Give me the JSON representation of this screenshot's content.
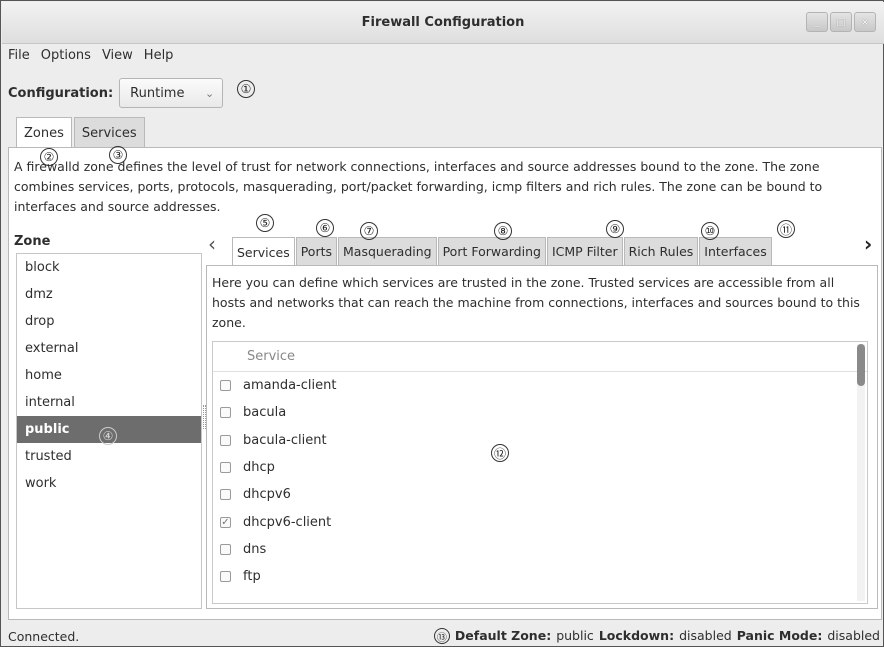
{
  "window": {
    "title": "Firewall Configuration"
  },
  "window_controls": [
    "_",
    "□",
    "×"
  ],
  "menu": [
    "File",
    "Options",
    "View",
    "Help"
  ],
  "configuration": {
    "label": "Configuration:",
    "value": "Runtime"
  },
  "outer_tabs": [
    "Zones",
    "Services"
  ],
  "zones_description": "A firewalld zone defines the level of trust for network connections, interfaces and source addresses bound to the zone. The zone combines services, ports, protocols, masquerading, port/packet forwarding, icmp filters and rich rules. The zone can be bound to interfaces and source addresses.",
  "zone_list": {
    "header": "Zone",
    "items": [
      "block",
      "dmz",
      "drop",
      "external",
      "home",
      "internal",
      "public",
      "trusted",
      "work"
    ],
    "selected": "public"
  },
  "inner_tabs": [
    "Services",
    "Ports",
    "Masquerading",
    "Port Forwarding",
    "ICMP Filter",
    "Rich Rules",
    "Interfaces"
  ],
  "services_description": "Here you can define which services are trusted in the zone. Trusted services are accessible from all hosts and networks that can reach the machine from connections, interfaces and sources bound to this zone.",
  "services_table": {
    "header": "Service",
    "rows": [
      {
        "name": "amanda-client",
        "checked": false
      },
      {
        "name": "bacula",
        "checked": false
      },
      {
        "name": "bacula-client",
        "checked": false
      },
      {
        "name": "dhcp",
        "checked": false
      },
      {
        "name": "dhcpv6",
        "checked": false
      },
      {
        "name": "dhcpv6-client",
        "checked": true
      },
      {
        "name": "dns",
        "checked": false
      },
      {
        "name": "ftp",
        "checked": false
      }
    ]
  },
  "callouts": [
    "①",
    "②",
    "③",
    "④",
    "⑤",
    "⑥",
    "⑦",
    "⑧",
    "⑨",
    "⑩",
    "⑪",
    "⑫",
    "⑬"
  ],
  "status": {
    "connected": "Connected.",
    "default_zone_label": "Default Zone:",
    "default_zone": "public",
    "lockdown_label": "Lockdown:",
    "lockdown": "disabled",
    "panic_label": "Panic Mode:",
    "panic": "disabled"
  }
}
